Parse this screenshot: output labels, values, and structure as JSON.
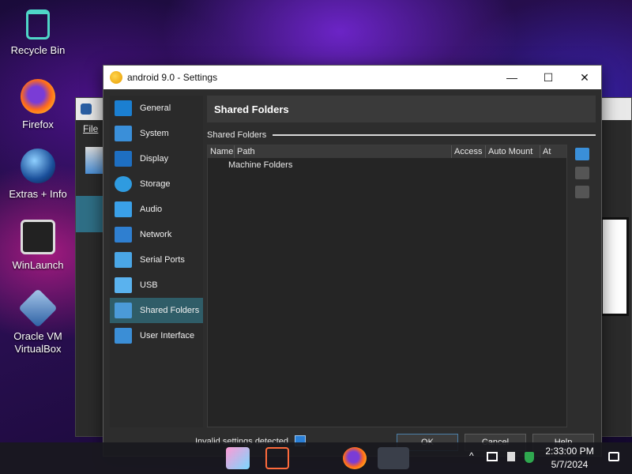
{
  "desktop": {
    "icons": [
      {
        "label": "Recycle Bin",
        "icon": "recycle-bin-icon"
      },
      {
        "label": "Firefox",
        "icon": "firefox-icon"
      },
      {
        "label": "Extras + Info",
        "icon": "extras-info-icon"
      },
      {
        "label": "WinLaunch",
        "icon": "winlaunch-icon"
      },
      {
        "label_line1": "Oracle VM",
        "label_line2": "VirtualBox",
        "icon": "virtualbox-icon"
      }
    ]
  },
  "bg_window": {
    "menu_file": "File"
  },
  "dialog": {
    "title": "android 9.0 - Settings",
    "controls": {
      "minimize": "—",
      "maximize": "☐",
      "close": "✕"
    },
    "sidebar": [
      {
        "label": "General",
        "icon": "general-icon",
        "color": "#1b7fd1"
      },
      {
        "label": "System",
        "icon": "system-icon",
        "color": "#3a8fd9"
      },
      {
        "label": "Display",
        "icon": "display-icon",
        "color": "#1e6fc2"
      },
      {
        "label": "Storage",
        "icon": "storage-icon",
        "color": "#2f9be0"
      },
      {
        "label": "Audio",
        "icon": "audio-icon",
        "color": "#3aa0e8"
      },
      {
        "label": "Network",
        "icon": "network-icon",
        "color": "#2f7fd0"
      },
      {
        "label": "Serial Ports",
        "icon": "serial-ports-icon",
        "color": "#4aa6e6"
      },
      {
        "label": "USB",
        "icon": "usb-icon",
        "color": "#5ab2ee"
      },
      {
        "label": "Shared Folders",
        "icon": "shared-folders-icon",
        "color": "#4b9ad8",
        "selected": true
      },
      {
        "label": "User Interface",
        "icon": "user-interface-icon",
        "color": "#3b8ed6"
      }
    ],
    "page_title": "Shared Folders",
    "group_label": "Shared Folders",
    "columns": [
      "Name",
      "Path",
      "Access",
      "Auto Mount",
      "At"
    ],
    "rows": [
      "Machine Folders"
    ],
    "footer": {
      "warning": "Invalid settings detected",
      "ok": "OK",
      "cancel": "Cancel",
      "help": "Help"
    }
  },
  "taskbar": {
    "time": "2:33:00 PM",
    "date": "5/7/2024",
    "tray_chevron": "^"
  },
  "colors": {
    "accent_selected": "#2f5d68",
    "dialog_bg": "#2d2d2d"
  }
}
